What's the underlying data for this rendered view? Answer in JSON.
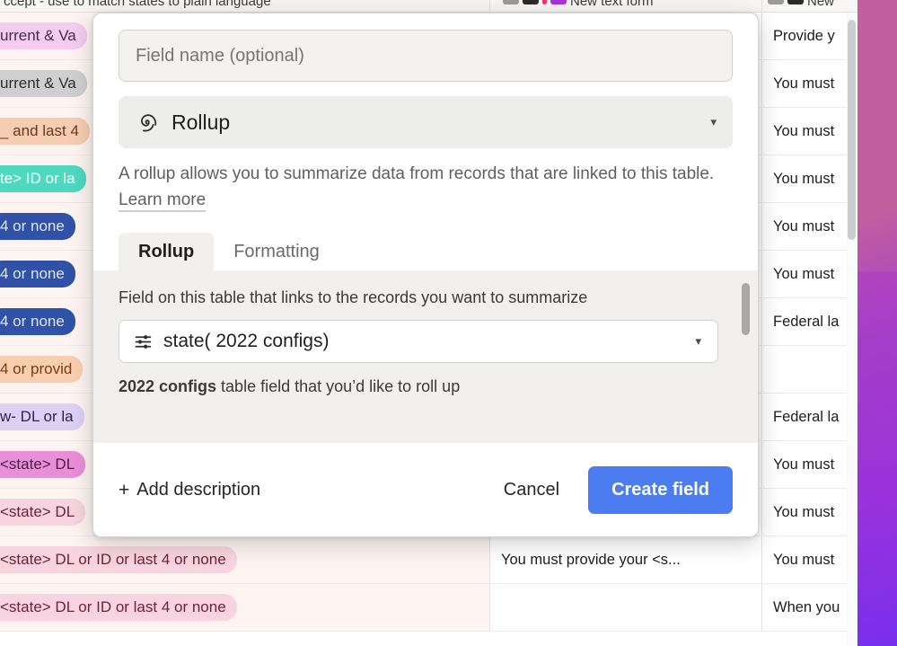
{
  "grid": {
    "column_headers": [
      "ccept - use to match states to plain language",
      "New text form",
      "New"
    ],
    "rows": [
      {
        "a_text": "urrent & Va",
        "a_style": "pill-lilac",
        "b_text": "",
        "c_text": "Provide y"
      },
      {
        "a_text": "urrent & Va",
        "a_style": "pill-grey",
        "b_text": "",
        "c_text": "You must"
      },
      {
        "a_text": "_ and last 4",
        "a_style": "pill-peach",
        "b_text": "",
        "c_text": "You must"
      },
      {
        "a_text": "te> ID or la",
        "a_style": "pill-teal",
        "b_text": "",
        "c_text": "You must"
      },
      {
        "a_text": "4 or none",
        "a_style": "pill-blue",
        "b_text": "",
        "c_text": "You must"
      },
      {
        "a_text": "4 or none",
        "a_style": "pill-blue",
        "b_text": "",
        "c_text": "You must"
      },
      {
        "a_text": "4 or none",
        "a_style": "pill-blue",
        "b_text": "",
        "c_text": "Federal la"
      },
      {
        "a_text": "4 or provid",
        "a_style": "pill-orange",
        "b_text": "",
        "c_text": ""
      },
      {
        "a_text": "w- DL or la",
        "a_style": "pill-violet",
        "b_text": "",
        "c_text": "Federal la"
      },
      {
        "a_text": "<state> DL",
        "a_style": "pill-magenta",
        "b_text": "",
        "c_text": "You must"
      },
      {
        "a_text": "<state> DL",
        "a_style": "pill-pink",
        "b_text": "",
        "c_text": "You must"
      },
      {
        "a_text": "<state> DL or ID or last 4 or none",
        "a_style": "pill-pink",
        "b_text": "You must provide your <s...",
        "c_text": "You must"
      },
      {
        "a_text": "<state> DL or ID or last 4 or none",
        "a_style": "pill-pink",
        "b_text": "",
        "c_text": "When you"
      }
    ]
  },
  "modal": {
    "field_name": {
      "value": "",
      "placeholder": "Field name (optional)"
    },
    "type_select": {
      "icon": "spiral-rollup-icon",
      "label": "Rollup",
      "caret": "▾"
    },
    "description": {
      "text": "A rollup allows you to summarize data from records that are linked to this table. ",
      "link_label": "Learn more"
    },
    "tabs": [
      {
        "label": "Rollup",
        "active": true
      },
      {
        "label": "Formatting",
        "active": false
      }
    ],
    "rollup_panel": {
      "link_field_label": "Field on this table that links to the records you want to summarize",
      "link_field_select": {
        "icon": "linked-record-icon",
        "value": "state( 2022 configs)",
        "caret": "▾"
      },
      "target_field_label_bold": "2022 configs",
      "target_field_label_rest": " table field that you’d like to roll up"
    },
    "footer": {
      "add_description_plus": "+",
      "add_description_label": "Add description",
      "cancel_label": "Cancel",
      "create_label": "Create field"
    }
  },
  "colors": {
    "accent_blue": "#4c7df0",
    "panel_grey": "#f1f0ef",
    "input_grey": "#f3f2f1",
    "row_tint": "#fdf3f0"
  }
}
